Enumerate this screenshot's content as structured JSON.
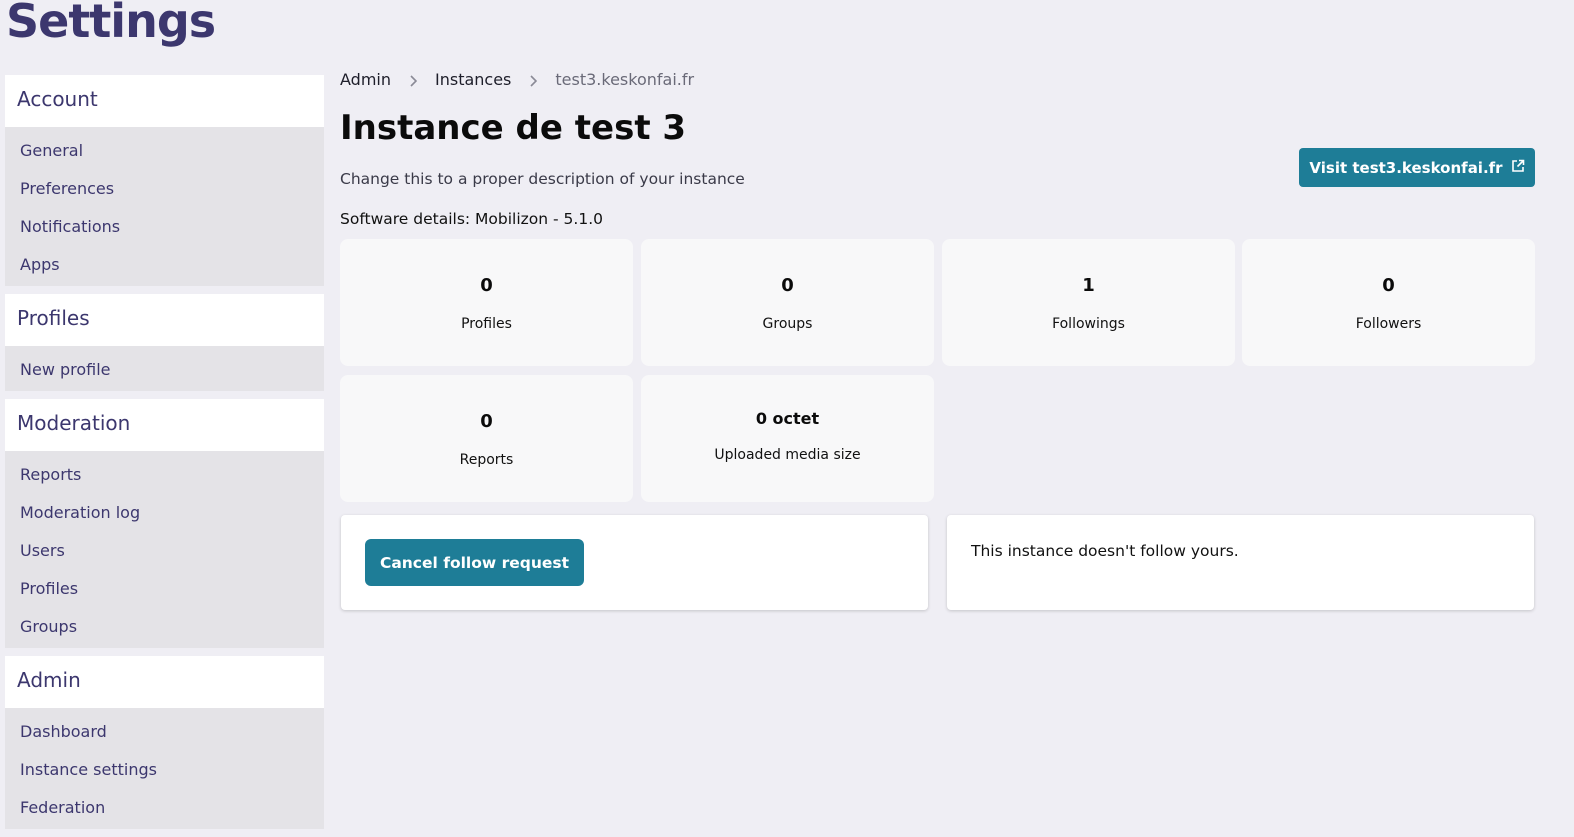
{
  "page_title": "Settings",
  "sidebar": {
    "sections": [
      {
        "heading": "Account",
        "items": [
          "General",
          "Preferences",
          "Notifications",
          "Apps"
        ]
      },
      {
        "heading": "Profiles",
        "items": [
          "New profile"
        ]
      },
      {
        "heading": "Moderation",
        "items": [
          "Reports",
          "Moderation log",
          "Users",
          "Profiles",
          "Groups"
        ]
      },
      {
        "heading": "Admin",
        "items": [
          "Dashboard",
          "Instance settings",
          "Federation"
        ]
      }
    ]
  },
  "breadcrumb": [
    "Admin",
    "Instances",
    "test3.keskonfai.fr"
  ],
  "instance": {
    "name": "Instance de test 3",
    "description": "Change this to a proper description of your instance",
    "software": "Software details: Mobilizon - 5.1.0",
    "visit_label": "Visit test3.keskonfai.fr"
  },
  "stats": [
    {
      "value": "0",
      "label": "Profiles"
    },
    {
      "value": "0",
      "label": "Groups"
    },
    {
      "value": "1",
      "label": "Followings"
    },
    {
      "value": "0",
      "label": "Followers"
    },
    {
      "value": "0",
      "label": "Reports"
    },
    {
      "value": "0 octet",
      "label": "Uploaded media size"
    }
  ],
  "follow": {
    "cancel_label": "Cancel follow request",
    "status_text": "This instance doesn't follow yours."
  },
  "colors": {
    "accent": "#1e7d97",
    "brand": "#3c376e",
    "background": "#efeef4"
  }
}
